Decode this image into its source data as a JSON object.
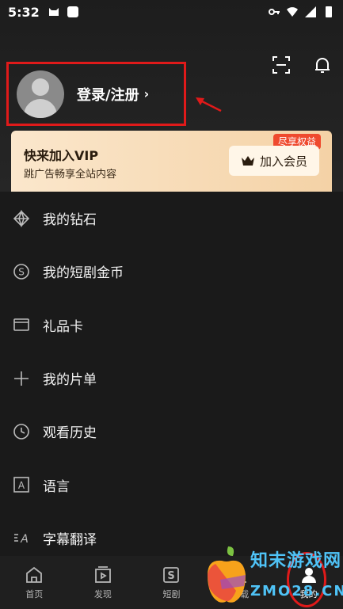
{
  "status_bar": {
    "time": "5:32"
  },
  "profile": {
    "login_label": "登录/注册",
    "chevron": "›"
  },
  "vip": {
    "title": "快来加入VIP",
    "subtitle": "跳广告畅享全站内容",
    "badge": "尽享权益",
    "button_label": "加入会员",
    "colors": {
      "gradient_start": "#fbe7cc",
      "gradient_end": "#f4d2a6",
      "badge": "#ef4a2e"
    }
  },
  "menu": {
    "items": [
      {
        "label": "我的钻石",
        "icon": "diamond-icon"
      },
      {
        "label": "我的短剧金币",
        "icon": "coin-icon"
      },
      {
        "label": "礼品卡",
        "icon": "gift-card-icon"
      },
      {
        "label": "我的片单",
        "icon": "plus-icon"
      },
      {
        "label": "观看历史",
        "icon": "history-icon"
      },
      {
        "label": "语言",
        "icon": "language-icon"
      },
      {
        "label": "字幕翻译",
        "icon": "subtitle-translate-icon"
      }
    ]
  },
  "bottom_nav": {
    "items": [
      {
        "label": "首页",
        "icon": "home-icon"
      },
      {
        "label": "发现",
        "icon": "discover-icon"
      },
      {
        "label": "短剧",
        "icon": "short-drama-icon"
      },
      {
        "label": "下载",
        "icon": "download-icon"
      },
      {
        "label": "我的",
        "icon": "profile-icon",
        "active": true
      }
    ]
  },
  "watermark": {
    "line1": "知末游戏网",
    "line2": "ZMO28.CN"
  },
  "colors": {
    "background": "#1a1a1a",
    "annotation_red": "#e01a1a"
  }
}
